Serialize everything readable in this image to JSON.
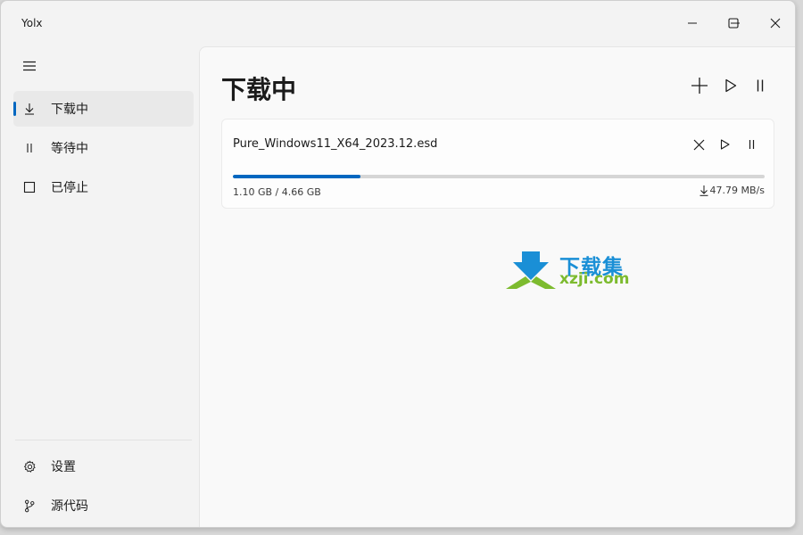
{
  "window": {
    "title": "Yolx"
  },
  "sidebar": {
    "items": [
      {
        "label": "下载中",
        "icon": "download-icon",
        "selected": true
      },
      {
        "label": "等待中",
        "icon": "pause-icon",
        "selected": false
      },
      {
        "label": "已停止",
        "icon": "square-icon",
        "selected": false
      }
    ],
    "footer_items": [
      {
        "label": "设置",
        "icon": "gear-icon"
      },
      {
        "label": "源代码",
        "icon": "git-branch-icon"
      }
    ]
  },
  "main": {
    "title": "下载中",
    "downloads": [
      {
        "file_name": "Pure_Windows11_X64_2023.12.esd",
        "progress_fraction": 0.24,
        "size_text": "1.10 GB / 4.66 GB",
        "speed": "47.79 MB/s"
      }
    ]
  },
  "watermark": {
    "cn": "下载集",
    "en": "xzji.com"
  },
  "colors": {
    "accent": "#0067c0",
    "watermark_blue": "#1a8fd6",
    "watermark_green": "#7dbb2f"
  }
}
